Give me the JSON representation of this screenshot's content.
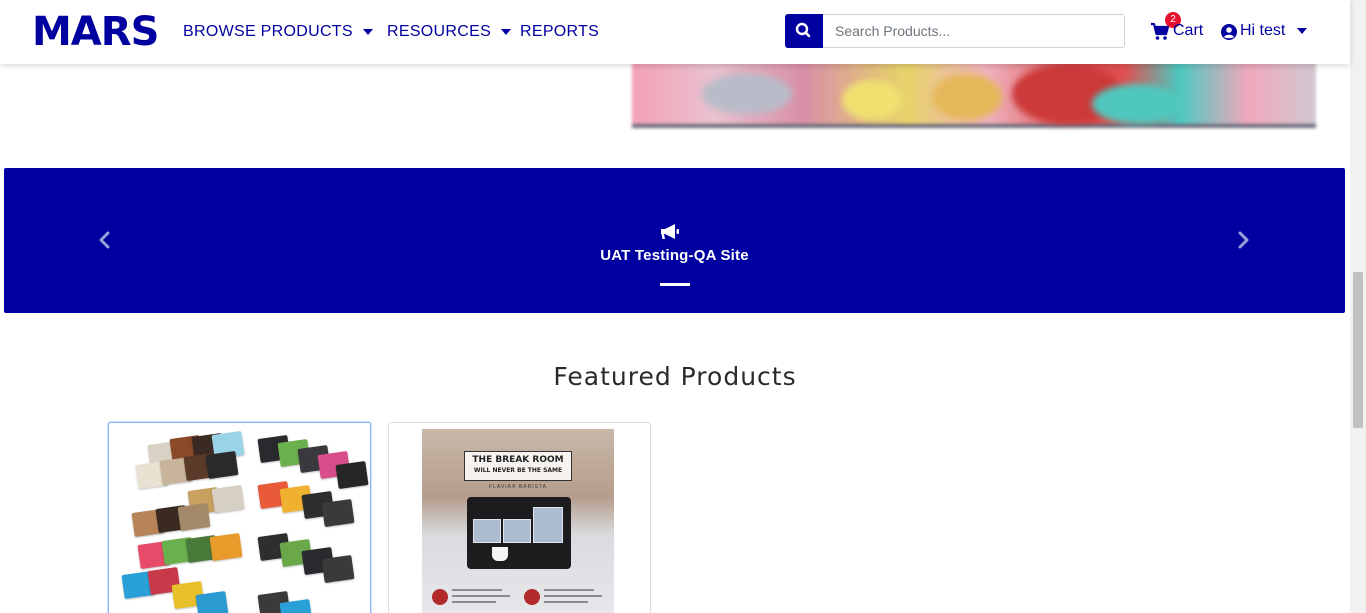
{
  "header": {
    "logo": "MARS",
    "nav": [
      {
        "label": "BROWSE PRODUCTS",
        "has_dropdown": true
      },
      {
        "label": "RESOURCES",
        "has_dropdown": true
      },
      {
        "label": "REPORTS",
        "has_dropdown": false
      }
    ],
    "search": {
      "placeholder": "Search Products...",
      "value": ""
    },
    "cart": {
      "label": "Cart",
      "count": "2"
    },
    "user": {
      "label": "Hi test"
    }
  },
  "banner": {
    "text": "UAT Testing-QA Site",
    "icon": "megaphone-icon",
    "slide_count": 1
  },
  "featured": {
    "title": "Featured Products",
    "products": [
      {
        "image": "coffee-pack-assortment",
        "selected": true
      },
      {
        "image": "break-room-poster",
        "selected": false
      }
    ],
    "poster_text": {
      "line1": "THE BREAK ROOM",
      "line2": "WILL NEVER BE THE SAME",
      "line3": "FLAVIA® BARISTA"
    }
  },
  "colors": {
    "brand": "#0000a0",
    "badge": "#e8112d",
    "banner_bg": "#0000a0"
  }
}
